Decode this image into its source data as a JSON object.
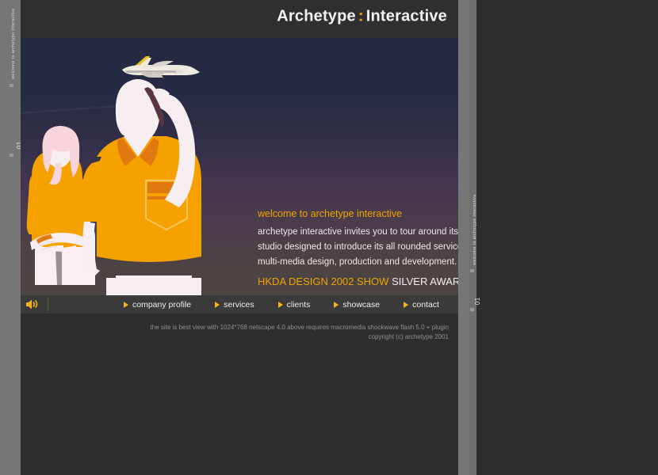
{
  "window": {
    "background_color": "#2e2e2e",
    "rail_color": "#767676"
  },
  "header": {
    "brand_first": "Archetype",
    "brand_separator": ":",
    "brand_second": "Interactive",
    "accent_color": "#f0a500"
  },
  "side_rails": {
    "vertical_label": "welcome to archetype interactive",
    "page_number": "01"
  },
  "hero": {
    "background_top_color": "#242a42",
    "background_bottom_color": "#4b4542",
    "airplane_icon": "airplane-icon",
    "figure_shirt_color": "#f5a200",
    "figure_skin_color": "#f7eef2",
    "figure_hair_color": "#f8d4dd"
  },
  "copy": {
    "headline": "welcome to archetype interactive",
    "paragraph_lines": [
      "archetype interactive invites you to tour around its onl",
      "studio designed to introduce its all rounded service in",
      "multi-media design, production and development."
    ],
    "award_gold": "HKDA DESIGN 2002 SHOW",
    "award_white": "SILVER AWARD"
  },
  "nav": {
    "sound_icon": "speaker-icon",
    "items": [
      {
        "label": "company profile"
      },
      {
        "label": "services"
      },
      {
        "label": "clients"
      },
      {
        "label": "showcase"
      },
      {
        "label": "contact"
      }
    ]
  },
  "footer": {
    "line1": "the site is best view with 1024*768 netscape 4.0 above requires macromedia shockwave flash 5.0 + plugin",
    "line2": "copyright (c) archetype 2001"
  }
}
